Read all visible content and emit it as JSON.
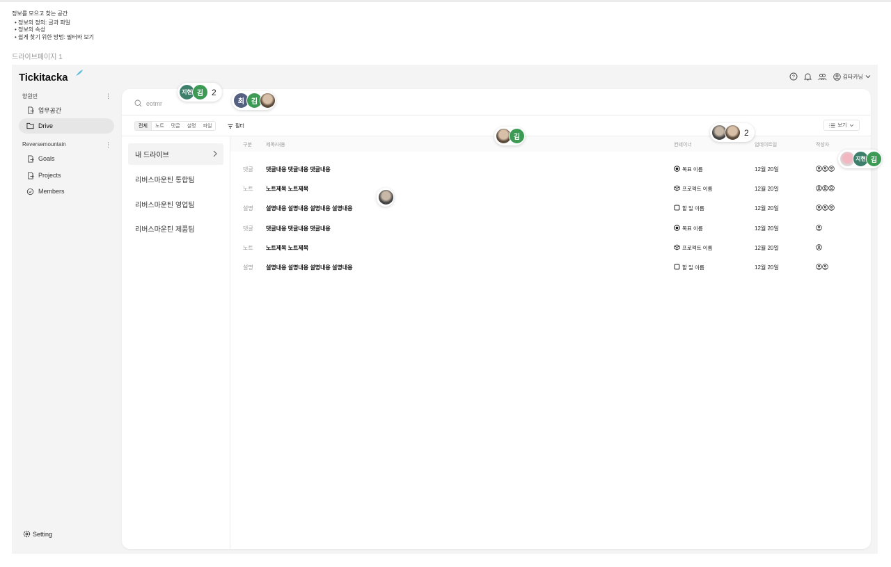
{
  "notes": {
    "title": "정보를 모으고 찾는 공간",
    "items": [
      "정보의 정의: 글과 파일",
      "정보의 속성",
      "쉽게 찾기 위한 방법: 필터와 보기"
    ]
  },
  "page_label": "드라이브페이지 1",
  "app": {
    "logo": "Tickitacka",
    "accent_color": "#5bbcdc"
  },
  "sidebar": {
    "section1": "양원민",
    "section1_items": [
      {
        "label": "업무공간",
        "icon": "file-share-icon"
      },
      {
        "label": "Drive",
        "icon": "folder-icon",
        "active": true
      }
    ],
    "section2": "Reversemountain",
    "section2_items": [
      {
        "label": "Goals",
        "icon": "file-share-icon"
      },
      {
        "label": "Projects",
        "icon": "file-share-icon"
      },
      {
        "label": "Members",
        "icon": "check-circle-icon"
      }
    ],
    "setting": "Setting"
  },
  "header": {
    "user_name": "김타카닝"
  },
  "search": {
    "placeholder": "eotmr"
  },
  "tabs": [
    "전체",
    "노트",
    "댓글",
    "설명",
    "파일"
  ],
  "filter_label": "필터",
  "view_label": "보기",
  "drives": [
    "내 드라이브",
    "리버스마운틴 통합팀",
    "리버스마운틴 영업팀",
    "리버스마운틴 제품팀"
  ],
  "table": {
    "headers": {
      "type": "구분",
      "title": "제목/내용",
      "container": "컨테이너",
      "date": "업데이트일",
      "author": "작성자"
    },
    "rows": [
      {
        "type": "댓글",
        "title": "댓글내용 댓글내용 댓글내용",
        "container": "목표 이름",
        "container_icon": "target-icon",
        "date": "12월 20일",
        "authors": 3
      },
      {
        "type": "노트",
        "title": "노트제목 노트제목",
        "container": "프로젝트 이름",
        "container_icon": "cube-icon",
        "date": "12월 20일",
        "authors": 3
      },
      {
        "type": "설명",
        "title": "설명내용 설명내용 설명내용 설명내용",
        "container": "할 일 이름",
        "container_icon": "square-icon",
        "date": "12월 20일",
        "authors": 3
      },
      {
        "type": "댓글",
        "title": "댓글내용 댓글내용 댓글내용",
        "container": "목표 이름",
        "container_icon": "target-icon",
        "date": "12월 20일",
        "authors": 1
      },
      {
        "type": "노트",
        "title": "노트제목 노트제목",
        "container": "프로젝트 이름",
        "container_icon": "cube-icon",
        "date": "12월 20일",
        "authors": 1
      },
      {
        "type": "설명",
        "title": "설명내용 설명내용 설명내용 설명내용",
        "container": "할 일 이름",
        "container_icon": "square-icon",
        "date": "12월 20일",
        "authors": 2
      }
    ]
  },
  "collab_cursors": [
    {
      "avatars": [
        "지현",
        "김"
      ],
      "count": "2"
    },
    {
      "avatars": [
        "최",
        "김",
        ""
      ],
      "count": ""
    },
    {
      "avatars": [
        "",
        "김"
      ],
      "count": ""
    },
    {
      "avatars": [
        "",
        ""
      ],
      "count": "2"
    },
    {
      "avatars": [
        "",
        "지현",
        "김"
      ],
      "count": ""
    },
    {
      "avatars": [
        ""
      ],
      "count": ""
    }
  ],
  "avatar_colors": {
    "jihyun": "#3e7f6c",
    "kim": "#3c9a55",
    "choi": "#556080"
  }
}
